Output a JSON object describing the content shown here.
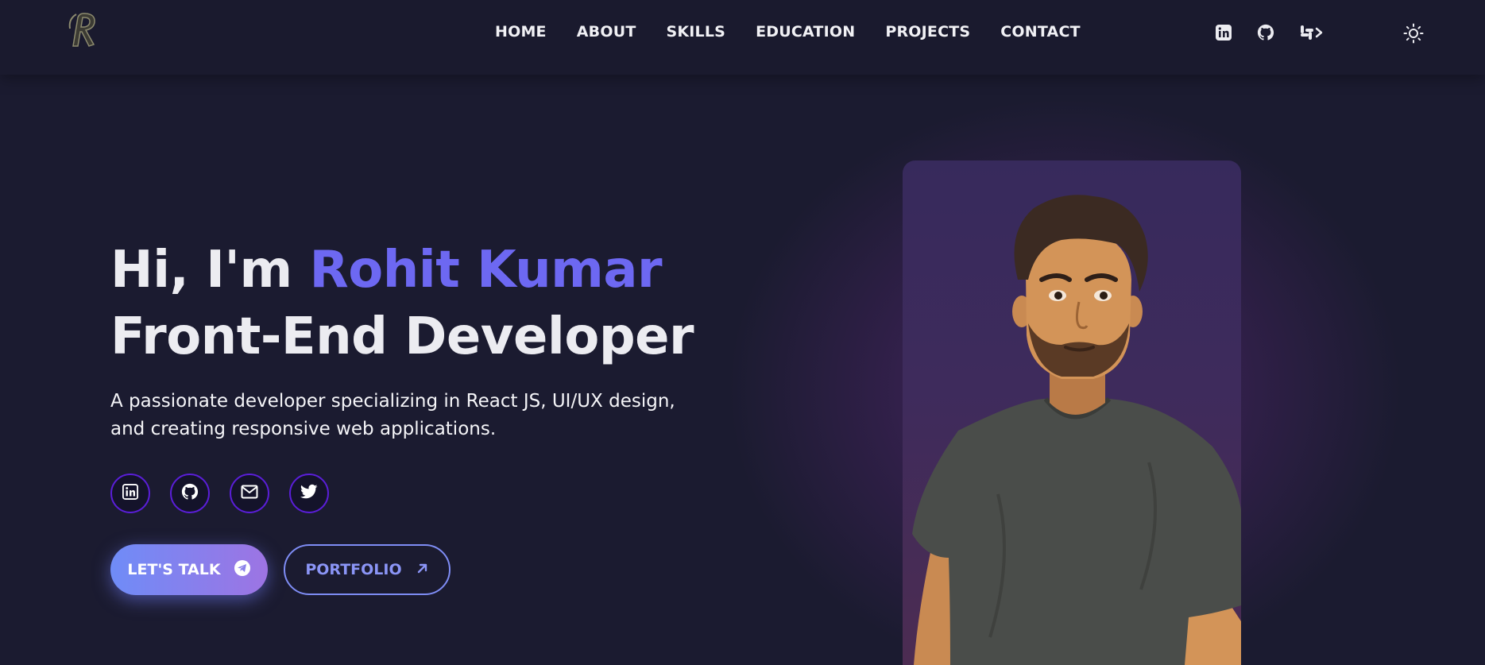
{
  "header": {
    "logo_alt": "R",
    "nav": [
      "HOME",
      "ABOUT",
      "SKILLS",
      "EDUCATION",
      "PROJECTS",
      "CONTACT"
    ],
    "icons": [
      "linkedin-icon",
      "github-icon",
      "slack-icon",
      "sun-icon"
    ]
  },
  "hero": {
    "greeting": "Hi, I'm ",
    "name": "Rohit Kumar",
    "role": "Front-End Developer",
    "description": "A passionate developer specializing in React JS, UI/UX design, and creating responsive web applications.",
    "socials": [
      "linkedin-icon",
      "github-icon",
      "mail-icon",
      "twitter-icon"
    ],
    "talk_label": "LET'S TALK",
    "portfolio_label": "PORTFOLIO"
  },
  "colors": {
    "background": "#1b1b30",
    "header": "#1a1a2e",
    "accent": "#6d68f2",
    "button_gradient_start": "#6f8cf7",
    "button_gradient_end": "#9d74e3",
    "social_border": "#5a1ed8"
  }
}
